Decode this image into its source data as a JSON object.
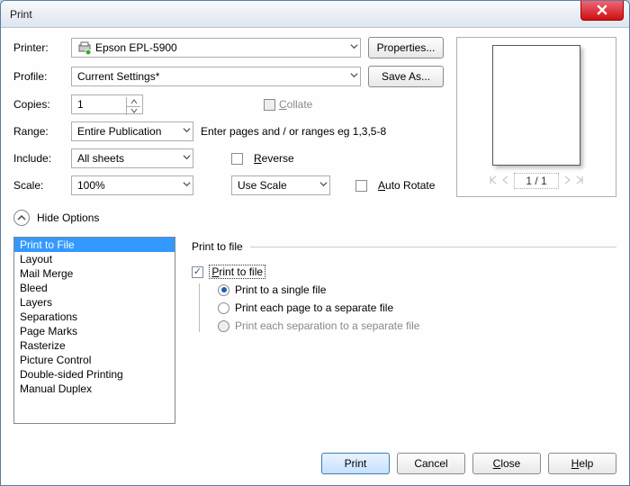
{
  "window": {
    "title": "Print"
  },
  "labels": {
    "printer": "Printer:",
    "profile": "Profile:",
    "copies": "Copies:",
    "range": "Range:",
    "include": "Include:",
    "scale": "Scale:"
  },
  "values": {
    "printer": "Epson EPL-5900",
    "profile": "Current Settings*",
    "copies": "1",
    "range": "Entire Publication",
    "include": "All sheets",
    "scale": "100%",
    "scale_mode": "Use Scale"
  },
  "buttons": {
    "properties": "Properties...",
    "saveas": "Save As...",
    "print": "Print",
    "cancel": "Cancel",
    "close": "Close",
    "help": "Help"
  },
  "checks": {
    "collate": "Collate",
    "reverse": "Reverse",
    "autorotate": "Auto Rotate"
  },
  "range_hint": "Enter pages and / or ranges eg 1,3,5-8",
  "options_toggle": "Hide Options",
  "preview": {
    "pager": "1 / 1"
  },
  "listbox": {
    "items": [
      "Print to File",
      "Layout",
      "Mail Merge",
      "Bleed",
      "Layers",
      "Separations",
      "Page Marks",
      "Rasterize",
      "Picture Control",
      "Double-sided Printing",
      "Manual Duplex"
    ],
    "selected_index": 0
  },
  "printtofile": {
    "section": "Print to file",
    "checkbox": "Print to file",
    "radio_single": "Print to a single file",
    "radio_pages": "Print each page to a separate file",
    "radio_separations": "Print each separation to a separate file",
    "selected_radio": 0
  }
}
